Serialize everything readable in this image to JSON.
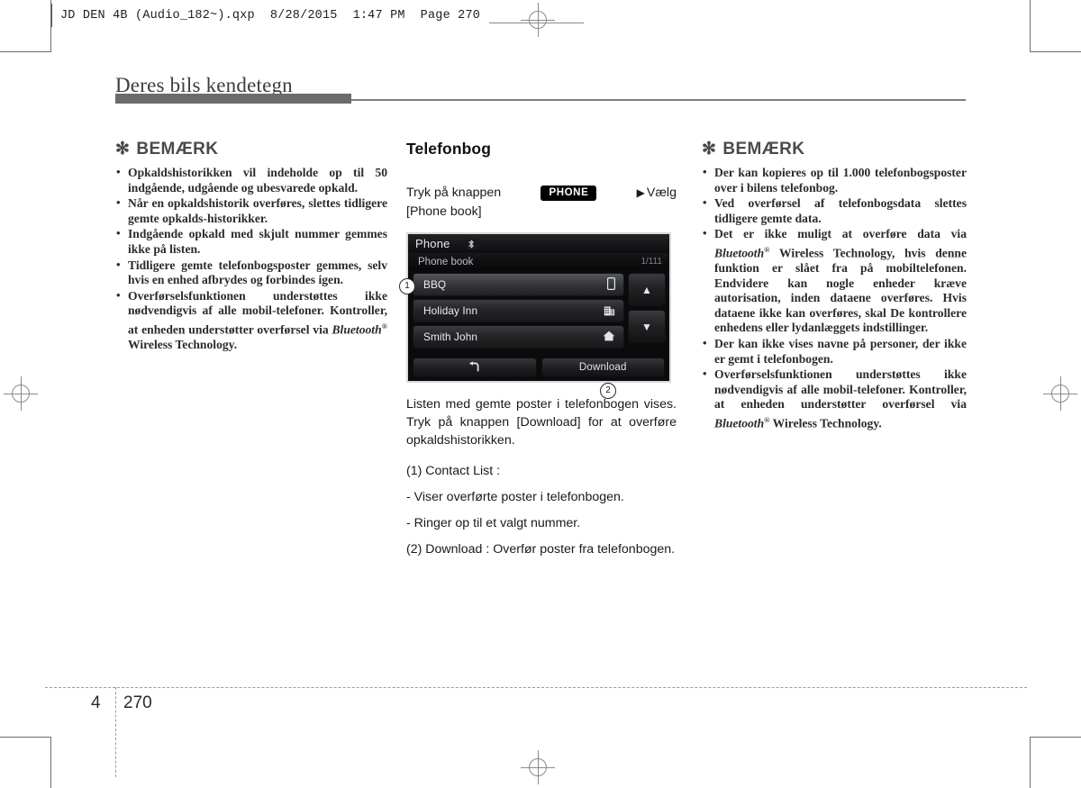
{
  "print_header": {
    "file_name": "JD DEN 4B (Audio_182~).qxp",
    "date": "8/28/2015",
    "time": "1:47 PM",
    "page_label": "Page 270"
  },
  "chapter": {
    "title": "Deres bils kendetegn",
    "number": "4",
    "page_number": "270"
  },
  "left_column": {
    "note_marker": "✻",
    "note_title": "BEMÆRK",
    "bullets": [
      "Opkaldshistorikken vil indeholde op til 50 indgående, udgående og ubesvarede opkald.",
      "Når en opkaldshistorik overføres, slettes tidligere gemte opkalds-historikker.",
      "Indgående opkald med skjult nummer gemmes ikke på listen.",
      "Tidligere gemte telefonbogsposter gemmes, selv hvis en enhed afbrydes og forbindes igen."
    ],
    "bullet_bluetooth": {
      "before": "Overførselsfunktionen understøttes ikke nødvendigvis af alle mobil-telefoner. Kontroller, at enheden understøtter overførsel via ",
      "brand": "Bluetooth",
      "registered": "®",
      "after": " Wireless Technology."
    }
  },
  "middle_column": {
    "heading": "Telefonbog",
    "instruction_prefix": "Tryk på knappen",
    "phone_button_label": "PHONE",
    "select_arrow": "▶",
    "select_word": "Vælg",
    "instruction_target": "[Phone book]",
    "device": {
      "title": "Phone",
      "bluetooth_icon": "bluetooth-icon",
      "sub_label": "Phone book",
      "count": "1/111",
      "rows": [
        {
          "name": "BBQ",
          "icon": "mobile-phone-icon",
          "glyph": "▯",
          "selected": true
        },
        {
          "name": "Holiday Inn",
          "icon": "office-building-icon",
          "glyph": "🏢",
          "selected": false
        },
        {
          "name": "Smith John",
          "icon": "home-icon",
          "glyph": "⌂",
          "selected": false
        }
      ],
      "scroll_up": "▲",
      "scroll_down": "▼",
      "back_button_glyph": "↰",
      "download_button_label": "Download",
      "callout_1": "①",
      "callout_2": "②"
    },
    "body_paragraph": "Listen med gemte poster i telefonbogen vises. Tryk på knappen [Download] for at overføre opkaldshistorikken.",
    "legend": [
      "(1) Contact List :",
      "- Viser overførte poster i telefonbogen.",
      "- Ringer op til et valgt nummer.",
      "(2) Download : Overfør poster fra telefonbogen."
    ]
  },
  "right_column": {
    "note_marker": "✻",
    "note_title": "BEMÆRK",
    "bullets_plain_top": [
      "Der kan kopieres op til 1.000 telefonbogsposter over i bilens telefonbog.",
      "Ved overførsel af telefonbogsdata slettes tidligere gemte data."
    ],
    "bullet_bluetooth_transfer": {
      "before": "Det er ikke muligt at overføre data via ",
      "brand": "Bluetooth",
      "registered": "®",
      "after": " Wireless Technology, hvis denne funktion er slået fra på mobiltelefonen. Endvidere kan nogle enheder kræve autorisation, inden dataene overføres. Hvis dataene ikke kan overføres, skal De kontrollere enhedens eller lydanlæggets indstillinger."
    },
    "bullet_names": "Der kan ikke vises navne på personer, der ikke er gemt i telefonbogen.",
    "bullet_bluetooth_support": {
      "before": "Overførselsfunktionen understøttes ikke nødvendigvis af alle mobil-telefoner. Kontroller, at enheden understøtter overførsel via ",
      "brand": "Bluetooth",
      "registered": "®",
      "after": " Wireless Technology."
    }
  }
}
